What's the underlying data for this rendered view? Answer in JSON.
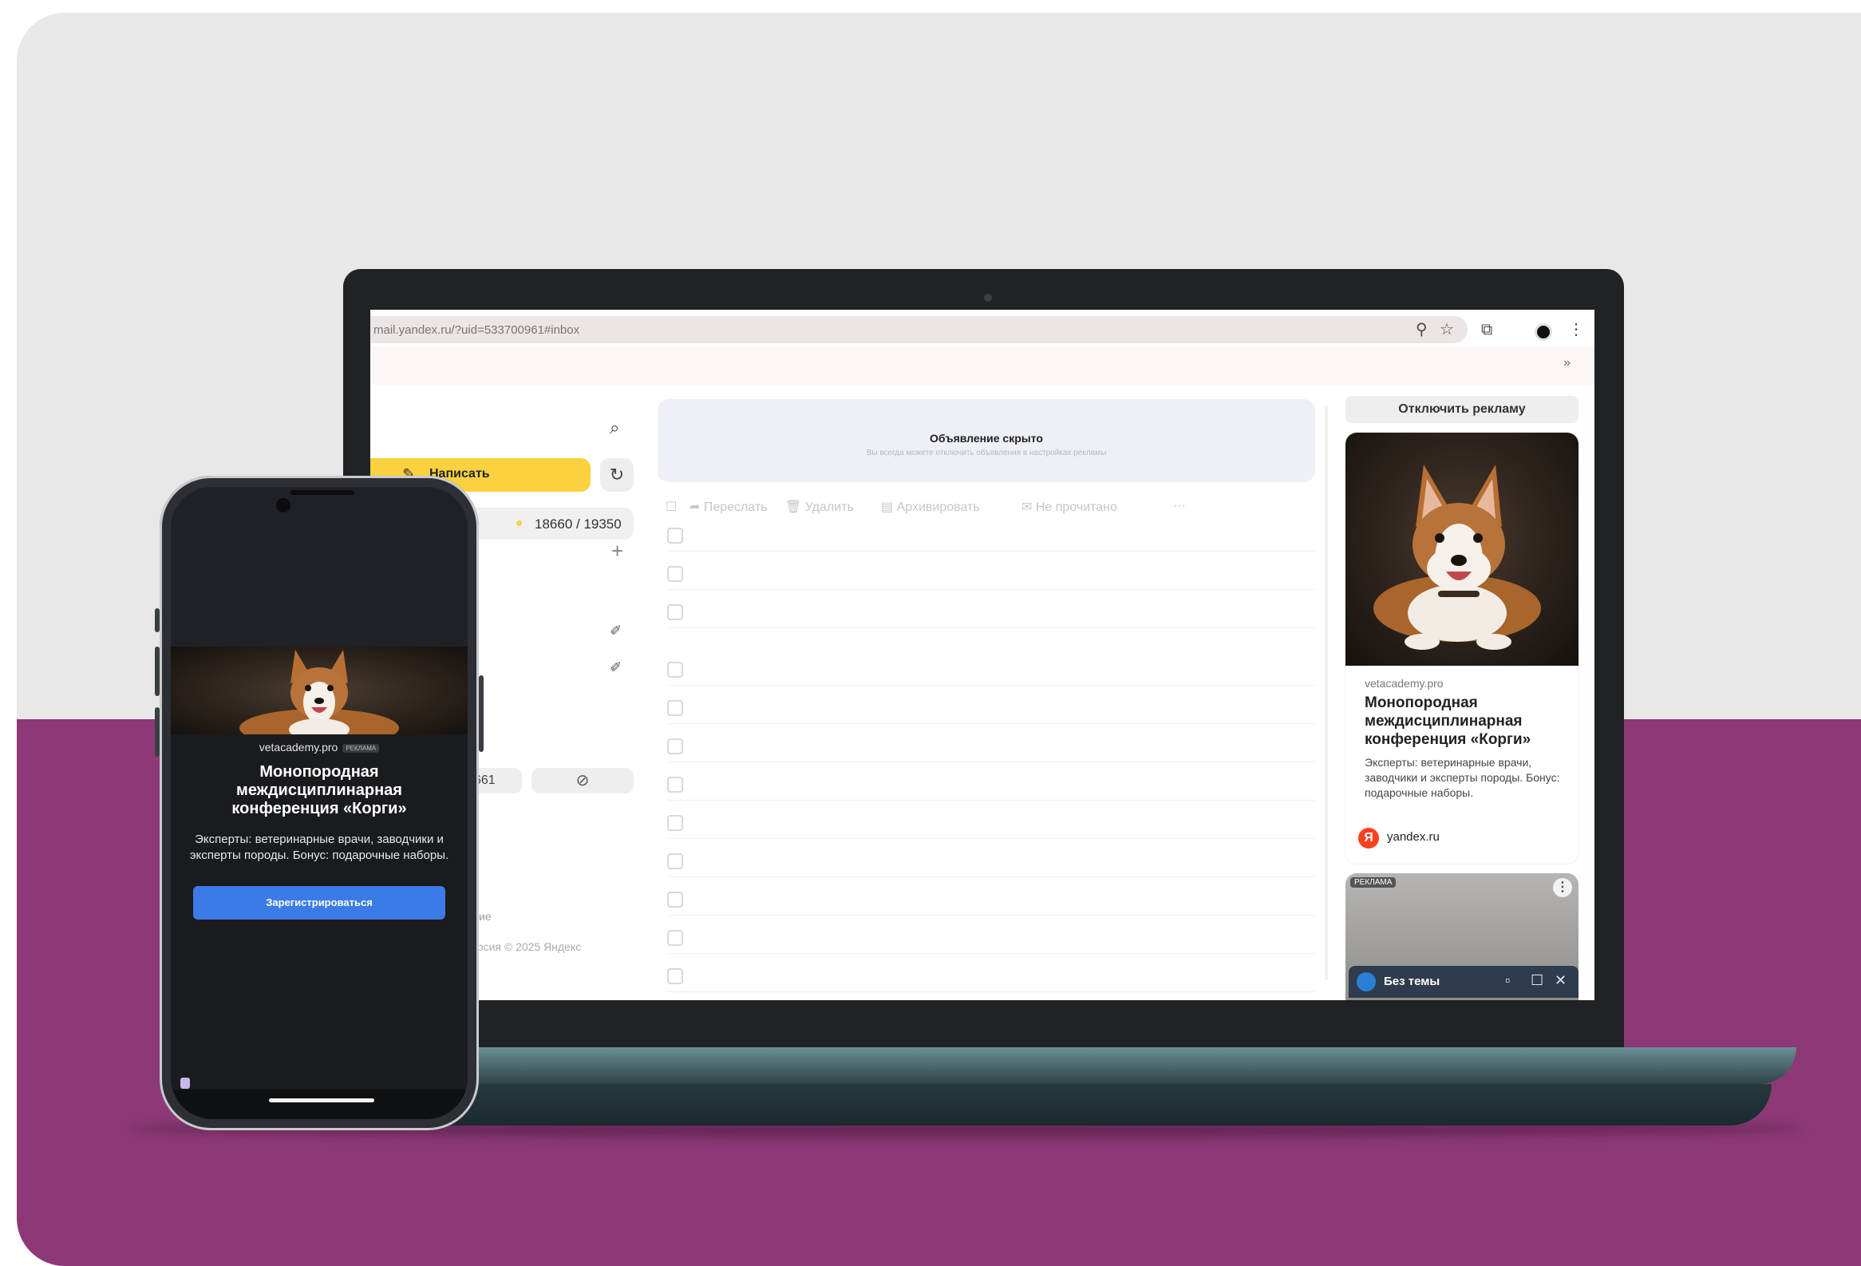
{
  "browser": {
    "url": "mail.yandex.ru/?uid=533700961#inbox",
    "toolbar_icons": [
      "zoom-icon",
      "star-icon",
      "extensions-icon",
      "profile-icon",
      "menu-icon"
    ],
    "bookmarks_more": "»"
  },
  "mail": {
    "compose_label": "Написать",
    "inbox_count": "18660 / 19350",
    "storage_text": "661",
    "footer_line1": "ие",
    "footer_line2": "ерсия  © 2025 Яндекс",
    "hidden_ad_title": "Объявление скрыто",
    "hidden_ad_sub": "Вы всегда можете отключить объявления в настройках рекламы",
    "toolbar": {
      "forward": "Переслать",
      "delete": "Удалить",
      "archive": "Архивировать",
      "unread": "Не прочитано",
      "more": "···"
    },
    "row_count": 12
  },
  "sidebar_ad": {
    "disable_ads": "Отключить рекламу",
    "domain": "vetacademy.pro",
    "title": "Монопородная междисциплинарная конференция «Корги»",
    "description": "Эксперты: ветеринарные врачи, заводчики и эксперты породы. Бонус: подарочные наборы.",
    "source_logo": "Я",
    "source": "yandex.ru",
    "second_ad_tag": "РЕКЛАМА",
    "kebab": "⋮"
  },
  "compose_window": {
    "title": "Без темы",
    "minimize": "▫",
    "expand": "☐",
    "close": "✕"
  },
  "phone_ad": {
    "domain": "vetacademy.pro",
    "tag": "РЕКЛАМА",
    "title": "Монопородная междисциплинарная конференция «Корги»",
    "description": "Эксперты: ветеринарные врачи, заводчики и эксперты породы. Бонус: подарочные наборы.",
    "cta": "Зарегистрироваться"
  },
  "colors": {
    "background_top": "#e8e8e8",
    "background_band": "#8d3977",
    "compose_yellow": "#fbd140",
    "cta_blue": "#3a7be8",
    "yandex_red": "#fc3f1d"
  }
}
